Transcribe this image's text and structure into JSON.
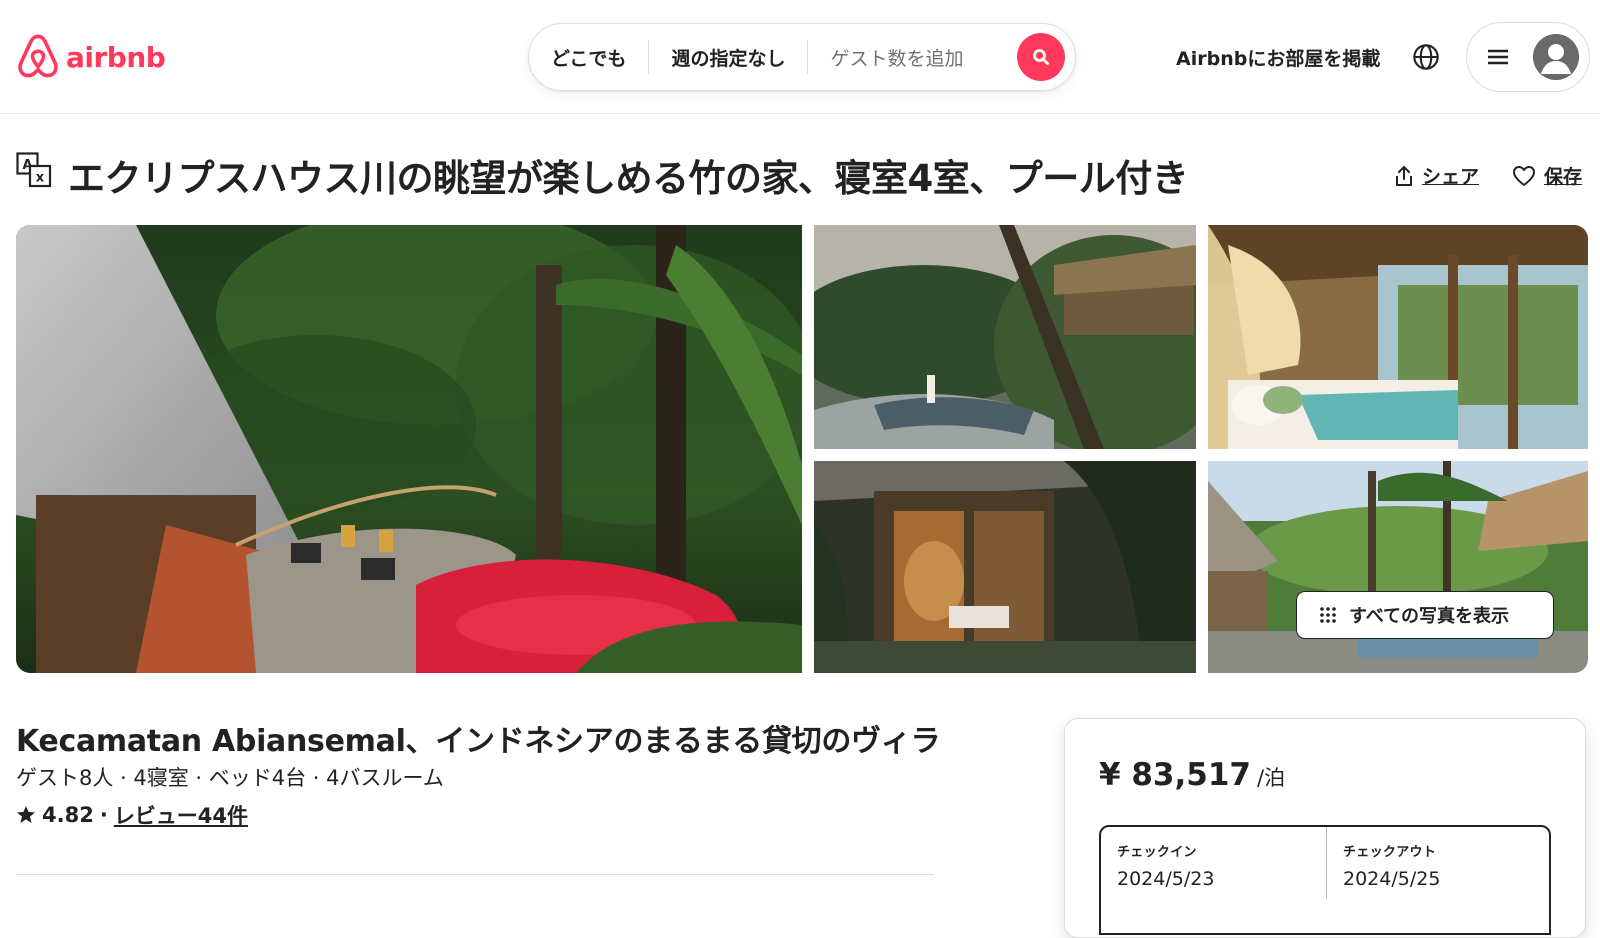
{
  "brand": {
    "name": "airbnb",
    "color": "#ff385c",
    "icon": "airbnb-logo-icon"
  },
  "search": {
    "location": "どこでも",
    "week": "週の指定なし",
    "guests_placeholder": "ゲスト数を追加",
    "button_icon": "search-icon"
  },
  "nav": {
    "host_link": "Airbnbにお部屋を掲載",
    "globe_icon": "globe-icon",
    "menu_icon": "hamburger-menu-icon",
    "avatar_icon": "user-avatar-icon"
  },
  "listing": {
    "title": "エクリプスハウス川の眺望が楽しめる竹の家、寝室4室、プール付き",
    "share_label": "シェア",
    "save_label": "保存",
    "show_all_photos": "すべての写真を表示",
    "location_title": "Kecamatan Abiansemal、インドネシアのまるまる貸切のヴィラ",
    "specs": "ゲスト8人 · 4寝室 · ベッド4台 · 4バスルーム",
    "rating": "4.82",
    "rating_sep": "·",
    "reviews": "レビュー44件"
  },
  "booking": {
    "price": "¥ 83,517",
    "per": "/泊",
    "checkin_label": "チェックイン",
    "checkin_value": "2024/5/23",
    "checkout_label": "チェックアウト",
    "checkout_value": "2024/5/25"
  }
}
